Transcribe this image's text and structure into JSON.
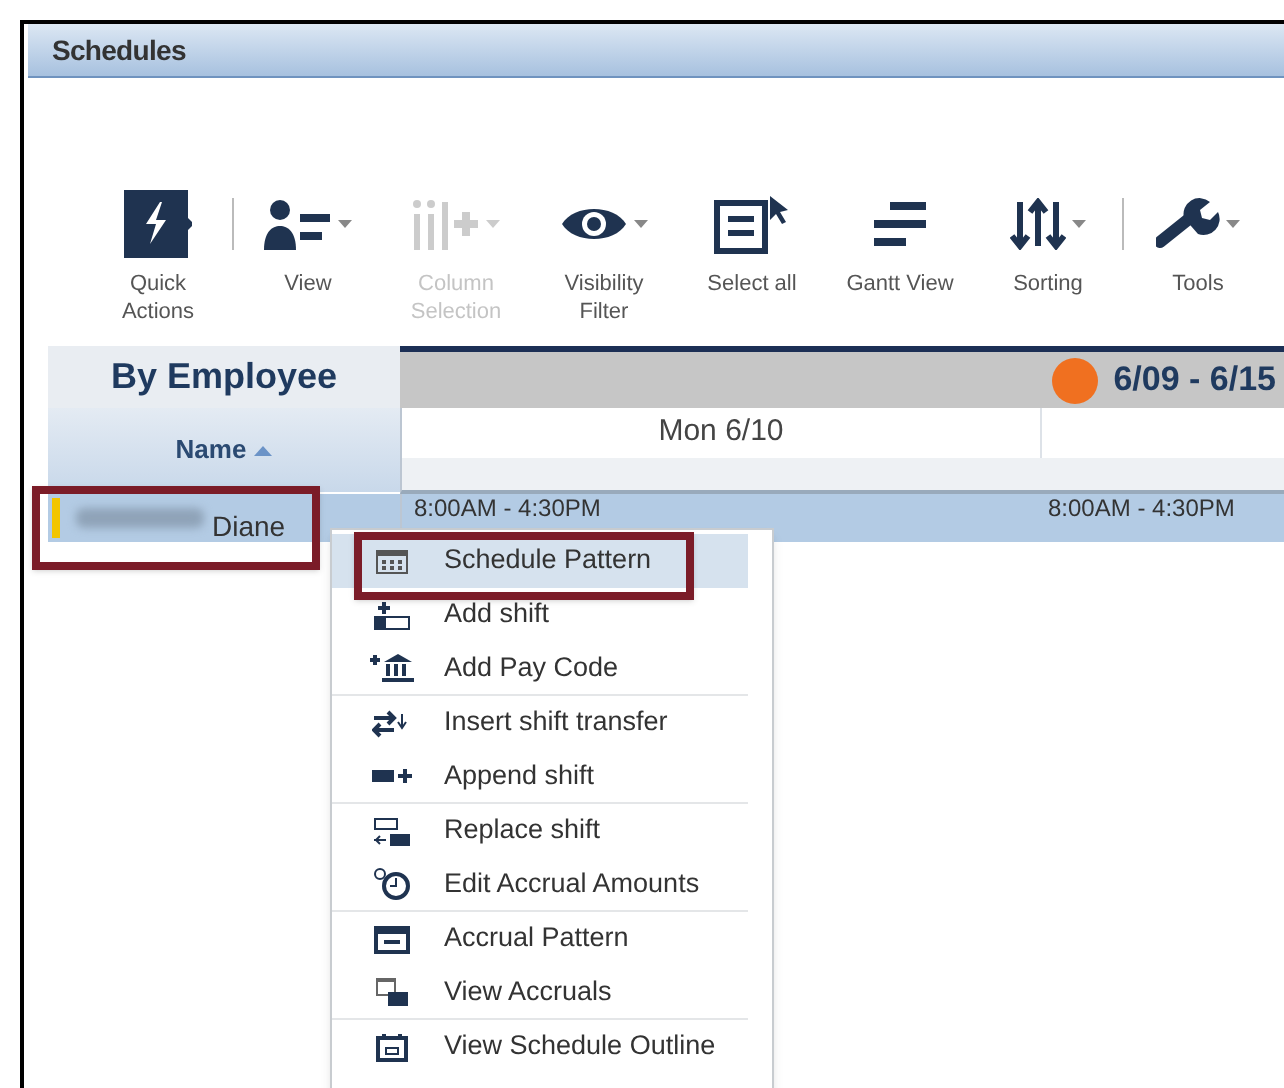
{
  "window": {
    "title": "Schedules"
  },
  "toolbar": {
    "groups": [
      [
        {
          "label": "Quick Actions",
          "dropdown": false,
          "disabled": false
        }
      ],
      [
        {
          "label": "View",
          "dropdown": true,
          "disabled": false
        },
        {
          "label": "Column Selection",
          "dropdown": true,
          "disabled": true
        },
        {
          "label": "Visibility Filter",
          "dropdown": true,
          "disabled": false
        },
        {
          "label": "Select all",
          "dropdown": false,
          "disabled": false
        },
        {
          "label": "Gantt View",
          "dropdown": false,
          "disabled": false
        },
        {
          "label": "Sorting",
          "dropdown": true,
          "disabled": false
        }
      ],
      [
        {
          "label": "Tools",
          "dropdown": true,
          "disabled": false
        }
      ]
    ]
  },
  "grid": {
    "panel_title": "By Employee",
    "name_column": {
      "label": "Name",
      "sorted_ascending": true
    },
    "period": {
      "label": "6/09 - 6/15",
      "color": "#f07020"
    },
    "days": [
      "Mon 6/10"
    ],
    "rows": [
      {
        "name": "Diane",
        "selected": true,
        "highlighted": true,
        "cells": [
          "8:00AM - 4:30PM",
          "8:00AM - 4:30PM"
        ]
      }
    ]
  },
  "context_menu": {
    "items": [
      {
        "label": "Schedule Pattern",
        "selected": true,
        "highlighted": true,
        "separator_after": false
      },
      {
        "label": "Add shift",
        "selected": false,
        "highlighted": false,
        "separator_after": false
      },
      {
        "label": "Add Pay Code",
        "selected": false,
        "highlighted": false,
        "separator_after": true
      },
      {
        "label": "Insert shift transfer",
        "selected": false,
        "highlighted": false,
        "separator_after": false
      },
      {
        "label": "Append shift",
        "selected": false,
        "highlighted": false,
        "separator_after": true
      },
      {
        "label": "Replace shift",
        "selected": false,
        "highlighted": false,
        "separator_after": false
      },
      {
        "label": "Edit Accrual Amounts",
        "selected": false,
        "highlighted": false,
        "separator_after": true
      },
      {
        "label": "Accrual Pattern",
        "selected": false,
        "highlighted": false,
        "separator_after": false
      },
      {
        "label": "View Accruals",
        "selected": false,
        "highlighted": false,
        "separator_after": true
      },
      {
        "label": "View Schedule Outline",
        "selected": false,
        "highlighted": false,
        "separator_after": false
      }
    ]
  }
}
